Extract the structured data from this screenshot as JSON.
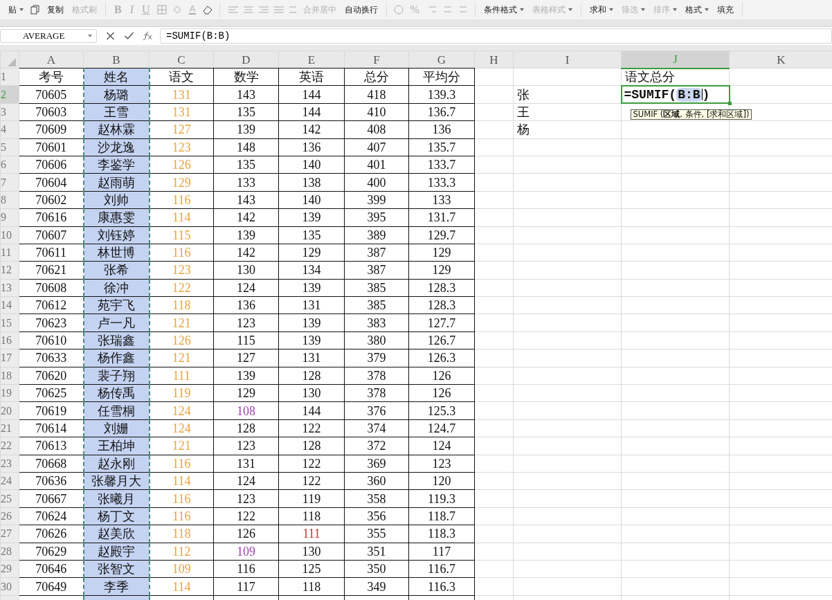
{
  "toolbar": {
    "sections": [
      {
        "kind": "clipboard",
        "items": [
          {
            "label": "贴",
            "caret": true,
            "disabled": false
          },
          {
            "label": "复制",
            "caret": false,
            "disabled": false
          },
          {
            "label": "格式刷",
            "caret": false,
            "disabled": true
          }
        ]
      },
      {
        "kind": "font",
        "items": [
          {
            "label": "B",
            "caret": false,
            "disabled": true
          },
          {
            "label": "I",
            "caret": false,
            "disabled": true
          },
          {
            "label": "U",
            "caret": false,
            "disabled": true
          }
        ]
      },
      {
        "kind": "align",
        "items": [
          {
            "label": "合并居中",
            "caret": false,
            "disabled": true
          },
          {
            "label": "自动换行",
            "caret": false,
            "disabled": false
          }
        ]
      },
      {
        "kind": "number",
        "items": [
          {
            "label": "%",
            "caret": false,
            "disabled": true
          }
        ]
      },
      {
        "kind": "styles",
        "items": [
          {
            "label": "条件格式",
            "caret": true,
            "disabled": false
          },
          {
            "label": "表格样式",
            "caret": true,
            "disabled": true
          }
        ]
      },
      {
        "kind": "editing",
        "items": [
          {
            "label": "求和",
            "caret": true,
            "disabled": false
          },
          {
            "label": "筛选",
            "caret": true,
            "disabled": true
          },
          {
            "label": "排序",
            "caret": true,
            "disabled": true
          },
          {
            "label": "格式",
            "caret": true,
            "disabled": false
          },
          {
            "label": "填充",
            "caret": false,
            "disabled": false
          }
        ]
      }
    ]
  },
  "formula_bar": {
    "name_box": "AVERAGE",
    "formula": "=SUMIF(B:B)"
  },
  "columns": [
    {
      "label": "A",
      "selected": false,
      "copied": false,
      "bordered": true
    },
    {
      "label": "B",
      "selected": false,
      "copied": true,
      "bordered": true
    },
    {
      "label": "C",
      "selected": false,
      "copied": false,
      "bordered": true
    },
    {
      "label": "D",
      "selected": false,
      "copied": false,
      "bordered": true
    },
    {
      "label": "E",
      "selected": false,
      "copied": false,
      "bordered": true
    },
    {
      "label": "F",
      "selected": false,
      "copied": false,
      "bordered": true
    },
    {
      "label": "G",
      "selected": false,
      "copied": false,
      "bordered": true
    },
    {
      "label": "H",
      "selected": false,
      "copied": false,
      "bordered": false
    },
    {
      "label": "I",
      "selected": false,
      "copied": false,
      "bordered": false
    },
    {
      "label": "J",
      "selected": true,
      "copied": false,
      "bordered": false
    },
    {
      "label": "K",
      "selected": false,
      "copied": false,
      "bordered": false
    }
  ],
  "rows": [
    {
      "number": "1",
      "selected": false,
      "cells": {
        "A": "考号",
        "B": "姓名",
        "C": "语文",
        "D": "数学",
        "E": "英语",
        "F": "总分",
        "G": "平均分",
        "J": "语文总分"
      }
    },
    {
      "number": "2",
      "selected": true,
      "cells": {
        "A": "70605",
        "B": "杨璐",
        "C": {
          "text": "131",
          "color": "#e8a33c"
        },
        "D": "143",
        "E": "144",
        "F": "418",
        "G": "139.3",
        "I": "张"
      },
      "editor": {
        "before": "=SUMIF(",
        "reference": "B:B",
        "after": ")",
        "tooltip": "SUMIF (**区域**, 条件, [求和区域])"
      }
    },
    {
      "number": "3",
      "selected": false,
      "cells": {
        "A": "70603",
        "B": "王雪",
        "C": {
          "text": "131",
          "color": "#e8a33c"
        },
        "D": "135",
        "E": "144",
        "F": "410",
        "G": "136.7",
        "I": "王"
      }
    },
    {
      "number": "4",
      "selected": false,
      "cells": {
        "A": "70609",
        "B": "赵林霖",
        "C": {
          "text": "127",
          "color": "#e8a33c"
        },
        "D": "139",
        "E": "142",
        "F": "408",
        "G": "136",
        "I": "杨"
      }
    },
    {
      "number": "5",
      "selected": false,
      "cells": {
        "A": "70601",
        "B": "沙龙逸",
        "C": {
          "text": "123",
          "color": "#e8a33c"
        },
        "D": "148",
        "E": "136",
        "F": "407",
        "G": "135.7"
      }
    },
    {
      "number": "6",
      "selected": false,
      "cells": {
        "A": "70606",
        "B": "李鉴学",
        "C": {
          "text": "126",
          "color": "#e8a33c"
        },
        "D": "135",
        "E": "140",
        "F": "401",
        "G": "133.7"
      }
    },
    {
      "number": "7",
      "selected": false,
      "cells": {
        "A": "70604",
        "B": "赵雨萌",
        "C": {
          "text": "129",
          "color": "#e8a33c"
        },
        "D": "133",
        "E": "138",
        "F": "400",
        "G": "133.3"
      }
    },
    {
      "number": "8",
      "selected": false,
      "cells": {
        "A": "70602",
        "B": "刘帅",
        "C": {
          "text": "116",
          "color": "#e8a33c"
        },
        "D": "143",
        "E": "140",
        "F": "399",
        "G": "133"
      }
    },
    {
      "number": "9",
      "selected": false,
      "cells": {
        "A": "70616",
        "B": "康惠雯",
        "C": {
          "text": "114",
          "color": "#e8a33c"
        },
        "D": "142",
        "E": "139",
        "F": "395",
        "G": "131.7"
      }
    },
    {
      "number": "10",
      "selected": false,
      "cells": {
        "A": "70607",
        "B": "刘钰婷",
        "C": {
          "text": "115",
          "color": "#e8a33c"
        },
        "D": "139",
        "E": "135",
        "F": "389",
        "G": "129.7"
      }
    },
    {
      "number": "11",
      "selected": false,
      "cells": {
        "A": "70611",
        "B": "林世博",
        "C": {
          "text": "116",
          "color": "#e8a33c"
        },
        "D": "142",
        "E": "129",
        "F": "387",
        "G": "129"
      }
    },
    {
      "number": "12",
      "selected": false,
      "cells": {
        "A": "70621",
        "B": "张希",
        "C": {
          "text": "123",
          "color": "#e8a33c"
        },
        "D": "130",
        "E": "134",
        "F": "387",
        "G": "129"
      }
    },
    {
      "number": "13",
      "selected": false,
      "cells": {
        "A": "70608",
        "B": "徐冲",
        "C": {
          "text": "122",
          "color": "#e8a33c"
        },
        "D": "124",
        "E": "139",
        "F": "385",
        "G": "128.3"
      }
    },
    {
      "number": "14",
      "selected": false,
      "cells": {
        "A": "70612",
        "B": "苑宇飞",
        "C": {
          "text": "118",
          "color": "#e8a33c"
        },
        "D": "136",
        "E": "131",
        "F": "385",
        "G": "128.3"
      }
    },
    {
      "number": "15",
      "selected": false,
      "cells": {
        "A": "70623",
        "B": "卢一凡",
        "C": {
          "text": "121",
          "color": "#e8a33c"
        },
        "D": "123",
        "E": "139",
        "F": "383",
        "G": "127.7"
      }
    },
    {
      "number": "16",
      "selected": false,
      "cells": {
        "A": "70610",
        "B": "张瑞鑫",
        "C": {
          "text": "126",
          "color": "#e8a33c"
        },
        "D": "115",
        "E": "139",
        "F": "380",
        "G": "126.7"
      }
    },
    {
      "number": "17",
      "selected": false,
      "cells": {
        "A": "70633",
        "B": "杨作鑫",
        "C": {
          "text": "121",
          "color": "#e8a33c"
        },
        "D": "127",
        "E": "131",
        "F": "379",
        "G": "126.3"
      }
    },
    {
      "number": "18",
      "selected": false,
      "cells": {
        "A": "70620",
        "B": "裴子翔",
        "C": {
          "text": "111",
          "color": "#e8a33c"
        },
        "D": "139",
        "E": "128",
        "F": "378",
        "G": "126"
      }
    },
    {
      "number": "19",
      "selected": false,
      "cells": {
        "A": "70625",
        "B": "杨传禹",
        "C": {
          "text": "119",
          "color": "#e8a33c"
        },
        "D": "129",
        "E": "130",
        "F": "378",
        "G": "126"
      }
    },
    {
      "number": "20",
      "selected": false,
      "cells": {
        "A": "70619",
        "B": "任雪桐",
        "C": {
          "text": "124",
          "color": "#e8a33c"
        },
        "D": {
          "text": "108",
          "color": "#a040b0"
        },
        "E": "144",
        "F": "376",
        "G": "125.3"
      }
    },
    {
      "number": "21",
      "selected": false,
      "cells": {
        "A": "70614",
        "B": "刘姗",
        "C": {
          "text": "124",
          "color": "#e8a33c"
        },
        "D": "128",
        "E": "122",
        "F": "374",
        "G": "124.7"
      }
    },
    {
      "number": "22",
      "selected": false,
      "cells": {
        "A": "70613",
        "B": "王柏坤",
        "C": {
          "text": "121",
          "color": "#e8a33c"
        },
        "D": "123",
        "E": "128",
        "F": "372",
        "G": "124"
      }
    },
    {
      "number": "23",
      "selected": false,
      "cells": {
        "A": "70668",
        "B": "赵永刚",
        "C": {
          "text": "116",
          "color": "#e8a33c"
        },
        "D": "131",
        "E": "122",
        "F": "369",
        "G": "123"
      }
    },
    {
      "number": "24",
      "selected": false,
      "cells": {
        "A": "70636",
        "B": "张馨月大",
        "C": {
          "text": "114",
          "color": "#e8a33c"
        },
        "D": "124",
        "E": "122",
        "F": "360",
        "G": "120"
      }
    },
    {
      "number": "25",
      "selected": false,
      "cells": {
        "A": "70667",
        "B": "张曦月",
        "C": {
          "text": "116",
          "color": "#e8a33c"
        },
        "D": "123",
        "E": "119",
        "F": "358",
        "G": "119.3"
      }
    },
    {
      "number": "26",
      "selected": false,
      "cells": {
        "A": "70624",
        "B": "杨丁文",
        "C": {
          "text": "116",
          "color": "#e8a33c"
        },
        "D": "122",
        "E": "118",
        "F": "356",
        "G": "118.7"
      }
    },
    {
      "number": "27",
      "selected": false,
      "cells": {
        "A": "70626",
        "B": "赵美欣",
        "C": {
          "text": "118",
          "color": "#e8a33c"
        },
        "D": "126",
        "E": {
          "text": "111",
          "color": "#d03030"
        },
        "F": "355",
        "G": "118.3"
      }
    },
    {
      "number": "28",
      "selected": false,
      "cells": {
        "A": "70629",
        "B": "赵殿宇",
        "C": {
          "text": "112",
          "color": "#e8a33c"
        },
        "D": {
          "text": "109",
          "color": "#a040b0"
        },
        "E": "130",
        "F": "351",
        "G": "117"
      }
    },
    {
      "number": "29",
      "selected": false,
      "cells": {
        "A": "70646",
        "B": "张智文",
        "C": {
          "text": "109",
          "color": "#e8a33c"
        },
        "D": "116",
        "E": "125",
        "F": "350",
        "G": "116.7"
      }
    },
    {
      "number": "30",
      "selected": false,
      "cells": {
        "A": "70649",
        "B": "李季",
        "C": {
          "text": "114",
          "color": "#e8a33c"
        },
        "D": "117",
        "E": "118",
        "F": "349",
        "G": "116.3"
      }
    }
  ]
}
